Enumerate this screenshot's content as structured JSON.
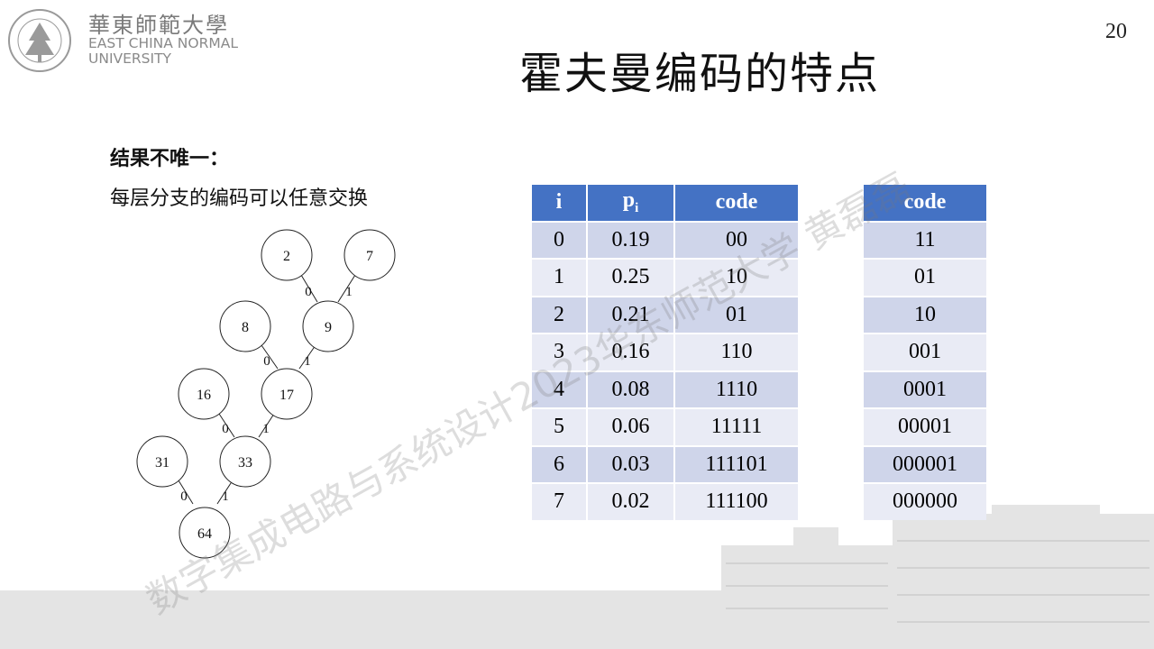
{
  "header": {
    "logo_cn": "華東師範大學",
    "logo_en_line1": "EAST CHINA NORMAL",
    "logo_en_line2": "UNIVERSITY",
    "page_number": "20",
    "title": "霍夫曼编码的特点"
  },
  "body": {
    "point_title": "结果不唯一：",
    "point_text": "每层分支的编码可以任意交换"
  },
  "tree": {
    "nodes": [
      "2",
      "7",
      "8",
      "9",
      "16",
      "17",
      "31",
      "33",
      "64"
    ],
    "edge_labels": [
      "0",
      "1",
      "0",
      "1",
      "0",
      "1",
      "0",
      "1"
    ]
  },
  "table1": {
    "headers": {
      "i": "i",
      "p_main": "p",
      "p_sub": "i",
      "code": "code"
    },
    "rows": [
      {
        "i": "0",
        "p": "0.19",
        "code": "00"
      },
      {
        "i": "1",
        "p": "0.25",
        "code": "10"
      },
      {
        "i": "2",
        "p": "0.21",
        "code": "01"
      },
      {
        "i": "3",
        "p": "0.16",
        "code": "110"
      },
      {
        "i": "4",
        "p": "0.08",
        "code": "1110"
      },
      {
        "i": "5",
        "p": "0.06",
        "code": "11111"
      },
      {
        "i": "6",
        "p": "0.03",
        "code": "111101"
      },
      {
        "i": "7",
        "p": "0.02",
        "code": "111100"
      }
    ]
  },
  "table2": {
    "header": "code",
    "rows": [
      "11",
      "01",
      "10",
      "001",
      "0001",
      "00001",
      "000001",
      "000000"
    ]
  },
  "watermark": "数字集成电路与系统设计2023华东师范大学 黄磊磊"
}
